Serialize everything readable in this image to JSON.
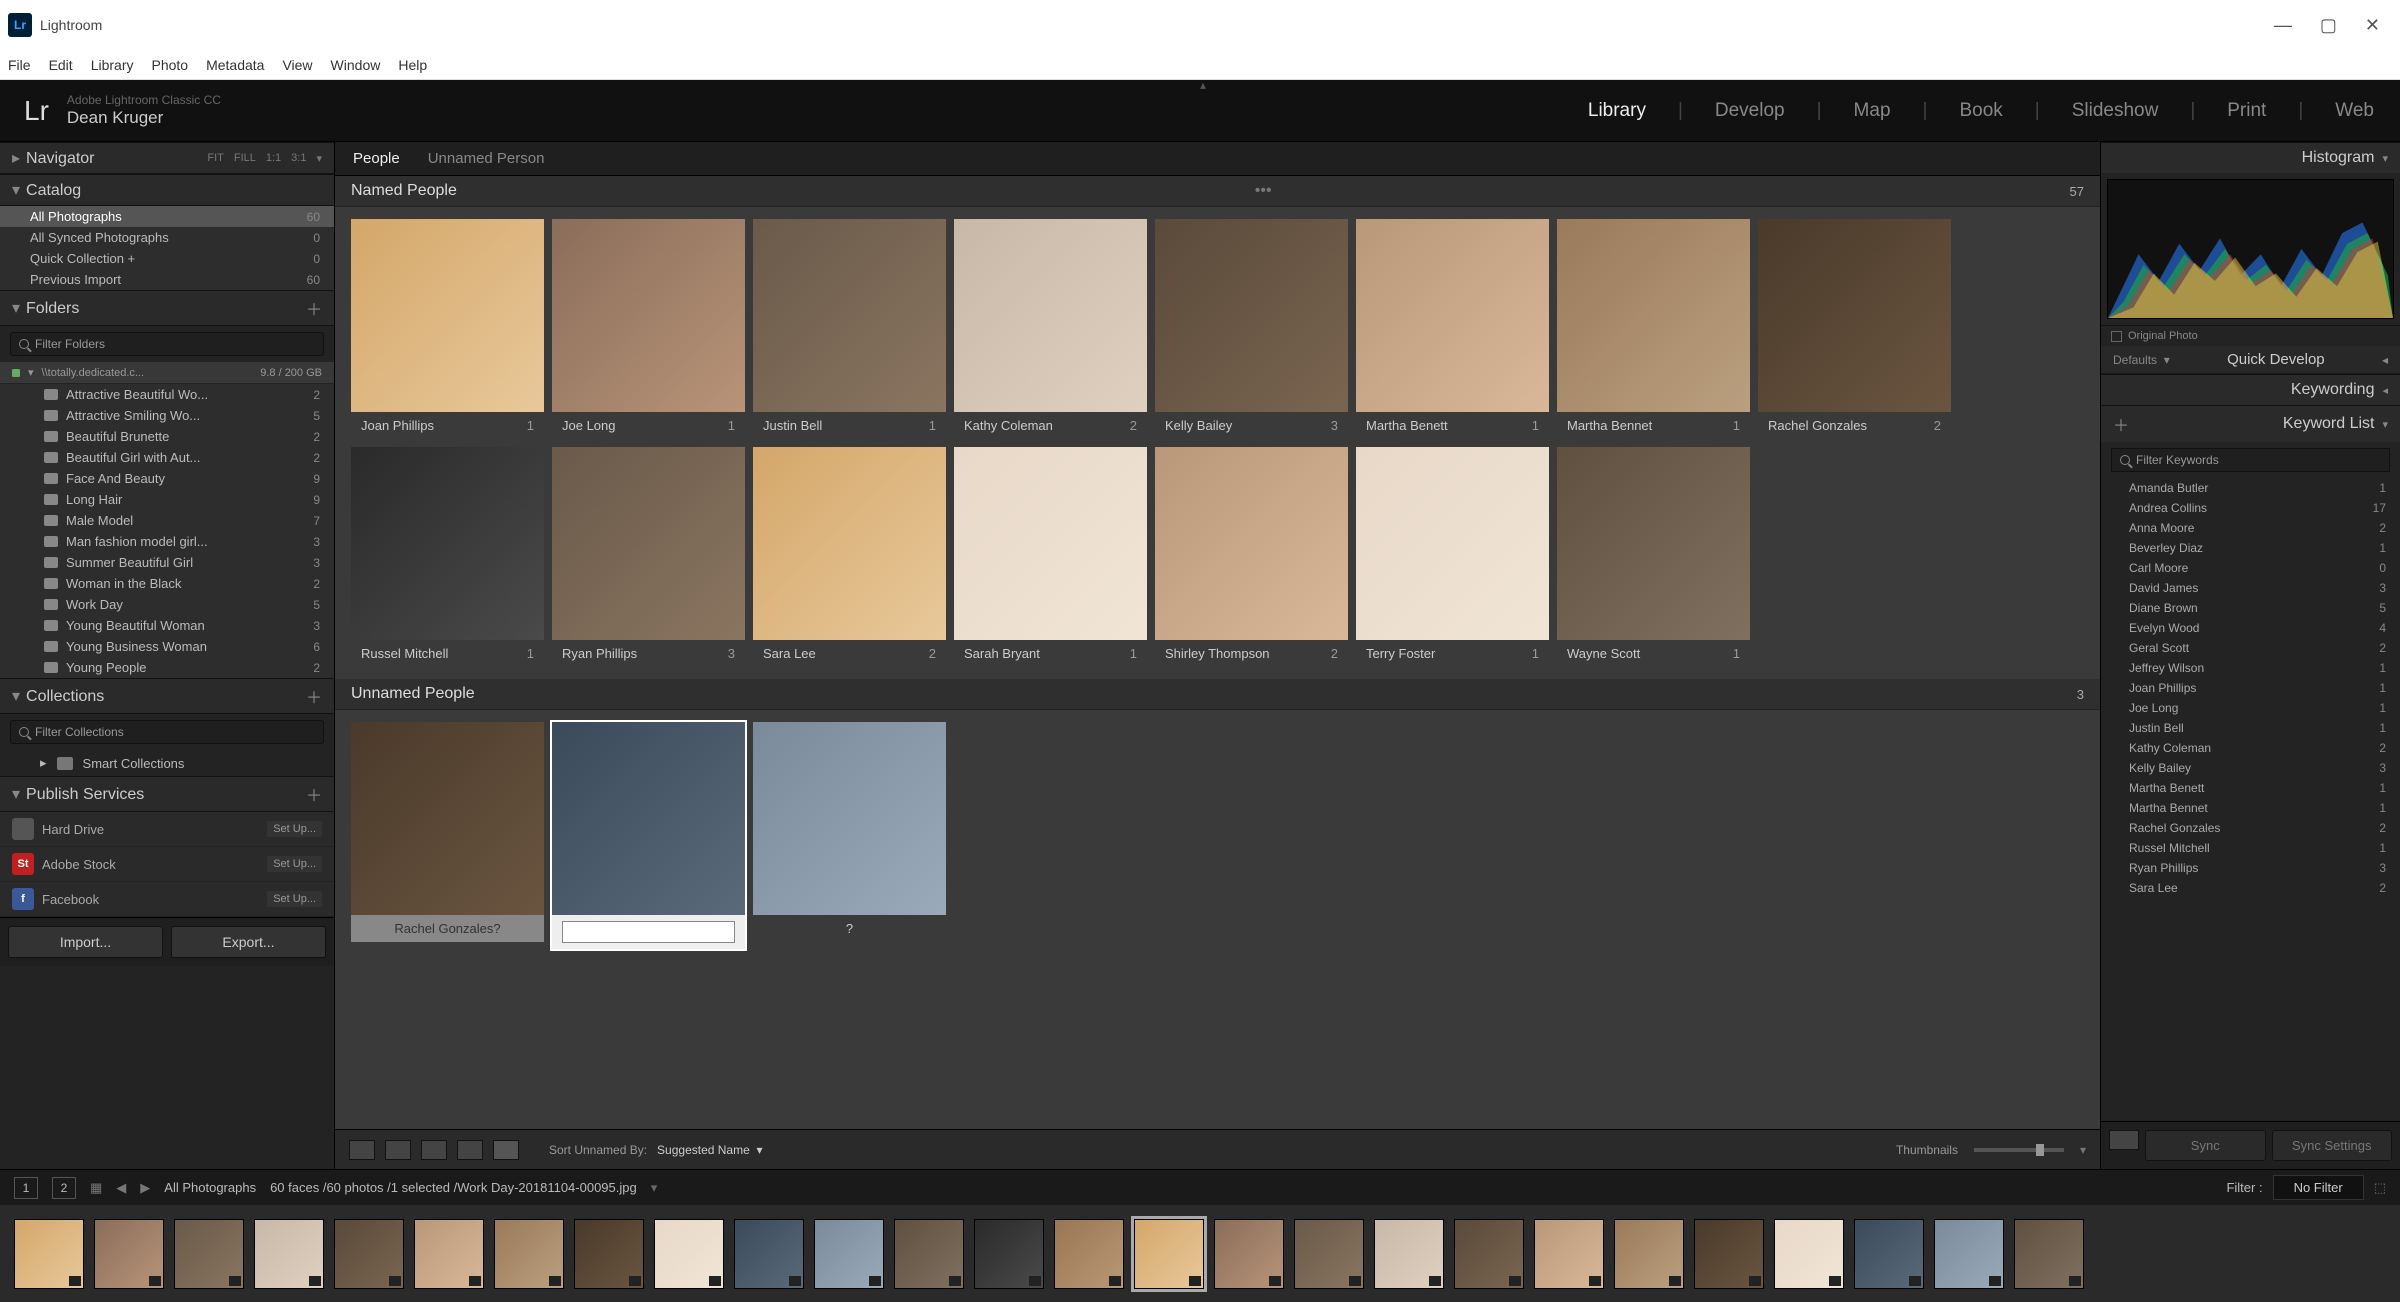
{
  "window": {
    "title": "Lightroom"
  },
  "menu": [
    "File",
    "Edit",
    "Library",
    "Photo",
    "Metadata",
    "View",
    "Window",
    "Help"
  ],
  "identity": {
    "product": "Adobe Lightroom Classic CC",
    "user": "Dean Kruger",
    "logo": "Lr"
  },
  "modules": [
    "Library",
    "Develop",
    "Map",
    "Book",
    "Slideshow",
    "Print",
    "Web"
  ],
  "modules_active": "Library",
  "left": {
    "navigator": {
      "title": "Navigator",
      "modes": [
        "FIT",
        "FILL",
        "1:1",
        "3:1"
      ]
    },
    "catalog": {
      "title": "Catalog",
      "items": [
        {
          "label": "All Photographs",
          "count": "60",
          "selected": true
        },
        {
          "label": "All Synced Photographs",
          "count": "0"
        },
        {
          "label": "Quick Collection  +",
          "count": "0"
        },
        {
          "label": "Previous Import",
          "count": "60"
        }
      ]
    },
    "folders": {
      "title": "Folders",
      "filter_placeholder": "Filter Folders",
      "volume": {
        "name": "\\\\totally.dedicated.c...",
        "space": "9.8 / 200 GB"
      },
      "items": [
        {
          "label": "Attractive Beautiful Wo...",
          "count": "2"
        },
        {
          "label": "Attractive Smiling Wo...",
          "count": "5"
        },
        {
          "label": "Beautiful Brunette",
          "count": "2"
        },
        {
          "label": "Beautiful Girl with Aut...",
          "count": "2"
        },
        {
          "label": "Face And Beauty",
          "count": "9"
        },
        {
          "label": "Long Hair",
          "count": "9"
        },
        {
          "label": "Male Model",
          "count": "7"
        },
        {
          "label": "Man fashion model girl...",
          "count": "3"
        },
        {
          "label": "Summer Beautiful Girl",
          "count": "3"
        },
        {
          "label": "Woman in the Black",
          "count": "2"
        },
        {
          "label": "Work Day",
          "count": "5"
        },
        {
          "label": "Young Beautiful Woman",
          "count": "3"
        },
        {
          "label": "Young Business Woman",
          "count": "6"
        },
        {
          "label": "Young People",
          "count": "2"
        }
      ]
    },
    "collections": {
      "title": "Collections",
      "filter_placeholder": "Filter Collections",
      "smart": "Smart Collections"
    },
    "publish": {
      "title": "Publish Services",
      "services": [
        {
          "name": "Hard Drive",
          "badge": "",
          "bg": "#555",
          "setup": "Set Up..."
        },
        {
          "name": "Adobe Stock",
          "badge": "St",
          "bg": "#c02020",
          "setup": "Set Up..."
        },
        {
          "name": "Facebook",
          "badge": "f",
          "bg": "#3b5998",
          "setup": "Set Up..."
        }
      ]
    },
    "buttons": {
      "import": "Import...",
      "export": "Export..."
    }
  },
  "center": {
    "tabs": [
      "People",
      "Unnamed Person"
    ],
    "tabs_active": "People",
    "named_title": "Named People",
    "named_count": "57",
    "named": [
      {
        "name": "Joan Phillips",
        "count": "1"
      },
      {
        "name": "Joe Long",
        "count": "1"
      },
      {
        "name": "Justin Bell",
        "count": "1"
      },
      {
        "name": "Kathy Coleman",
        "count": "2"
      },
      {
        "name": "Kelly Bailey",
        "count": "3"
      },
      {
        "name": "Martha Benett",
        "count": "1"
      },
      {
        "name": "Martha Bennet",
        "count": "1"
      },
      {
        "name": "Rachel Gonzales",
        "count": "2"
      },
      {
        "name": "Russel Mitchell",
        "count": "1"
      },
      {
        "name": "Ryan Phillips",
        "count": "3"
      },
      {
        "name": "Sara Lee",
        "count": "2"
      },
      {
        "name": "Sarah Bryant",
        "count": "1"
      },
      {
        "name": "Shirley Thompson",
        "count": "2"
      },
      {
        "name": "Terry Foster",
        "count": "1"
      },
      {
        "name": "Wayne Scott",
        "count": "1"
      }
    ],
    "unnamed_title": "Unnamed People",
    "unnamed_count": "3",
    "unnamed": [
      {
        "label": "Rachel Gonzales?",
        "selected": false
      },
      {
        "label": "",
        "selected": true,
        "editing": true
      },
      {
        "label": "?",
        "selected": false
      }
    ],
    "toolbar": {
      "sort_label": "Sort Unnamed By:",
      "sort_value": "Suggested Name",
      "thumbs": "Thumbnails"
    }
  },
  "right": {
    "histogram": "Histogram",
    "original": "Original Photo",
    "defaults": "Defaults",
    "quick_develop": "Quick Develop",
    "keywording": "Keywording",
    "keyword_list": "Keyword List",
    "filter_placeholder": "Filter Keywords",
    "keywords": [
      {
        "name": "Amanda Butler",
        "count": "1"
      },
      {
        "name": "Andrea Collins",
        "count": "17"
      },
      {
        "name": "Anna Moore",
        "count": "2"
      },
      {
        "name": "Beverley Diaz",
        "count": "1"
      },
      {
        "name": "Carl Moore",
        "count": "0"
      },
      {
        "name": "David James",
        "count": "3"
      },
      {
        "name": "Diane Brown",
        "count": "5"
      },
      {
        "name": "Evelyn Wood",
        "count": "4"
      },
      {
        "name": "Geral Scott",
        "count": "2"
      },
      {
        "name": "Jeffrey Wilson",
        "count": "1"
      },
      {
        "name": "Joan Phillips",
        "count": "1"
      },
      {
        "name": "Joe Long",
        "count": "1"
      },
      {
        "name": "Justin Bell",
        "count": "1"
      },
      {
        "name": "Kathy Coleman",
        "count": "2"
      },
      {
        "name": "Kelly Bailey",
        "count": "3"
      },
      {
        "name": "Martha Benett",
        "count": "1"
      },
      {
        "name": "Martha Bennet",
        "count": "1"
      },
      {
        "name": "Rachel Gonzales",
        "count": "2"
      },
      {
        "name": "Russel Mitchell",
        "count": "1"
      },
      {
        "name": "Ryan Phillips",
        "count": "3"
      },
      {
        "name": "Sara Lee",
        "count": "2"
      }
    ],
    "sync": "Sync",
    "sync_settings": "Sync Settings"
  },
  "status": {
    "pages": [
      "1",
      "2"
    ],
    "breadcrumb": "All Photographs",
    "info": "60 faces /60 photos /1 selected /Work Day-20181104-00095.jpg",
    "filter_label": "Filter :",
    "filter_value": "No Filter"
  },
  "filmstrip_count": 26
}
